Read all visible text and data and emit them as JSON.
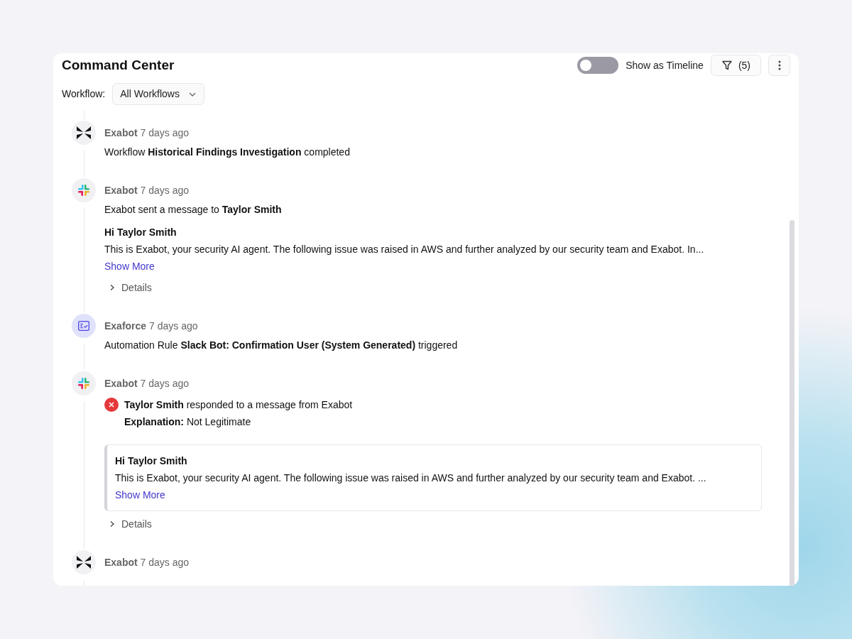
{
  "panel": {
    "title": "Command Center",
    "timeline_toggle": {
      "label": "Show as Timeline",
      "on": false
    },
    "filter_button": {
      "label": "(5)"
    }
  },
  "workflow_filter": {
    "label": "Workflow:",
    "value": "All Workflows"
  },
  "events": [
    {
      "kind": "exabot",
      "actor": "Exabot",
      "time": "7 days ago",
      "summary": "Workflow **Historical Findings Investigation** completed"
    },
    {
      "kind": "slack",
      "actor": "Exabot",
      "time": "7 days ago",
      "summary": "Exabot sent a message to **Taylor Smith**",
      "message": {
        "boxed": false,
        "heading": "Hi Taylor Smith",
        "body": "This is Exabot, your security AI agent. The following issue was raised in AWS and further analyzed by our security team and Exabot. In...",
        "link": "Show More"
      },
      "details": {
        "label": "Details",
        "expanded": false
      }
    },
    {
      "kind": "rule",
      "actor": "Exaforce",
      "time": "7 days ago",
      "summary": "Automation Rule **Slack Bot: Confirmation User (System Generated)** triggered"
    },
    {
      "kind": "slack",
      "actor": "Exabot",
      "time": "7 days ago",
      "response": {
        "rejected": true,
        "text": "**Taylor Smith** responded to a message from Exabot",
        "explanation": "**Explanation:** Not Legitimate"
      },
      "message": {
        "boxed": true,
        "heading": "Hi Taylor Smith",
        "body": "This is Exabot, your security AI agent. The following issue was raised in AWS and further analyzed by our security team and Exabot. ...",
        "link": "Show More"
      },
      "details": {
        "label": "Details",
        "expanded": false
      }
    },
    {
      "kind": "exabot",
      "actor": "Exabot",
      "time": "7 days ago"
    }
  ]
}
